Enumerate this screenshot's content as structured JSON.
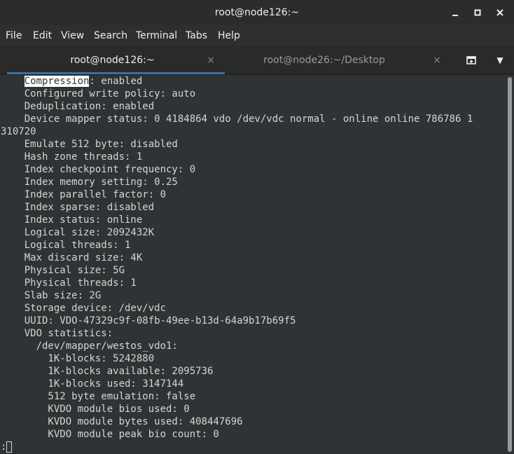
{
  "window": {
    "title": "root@node126:~",
    "minimize_label": "▁",
    "maximize_label": "□",
    "close_label": "✕"
  },
  "menubar": {
    "items": [
      "File",
      "Edit",
      "View",
      "Search",
      "Terminal",
      "Tabs",
      "Help"
    ]
  },
  "tabs": [
    {
      "label": "root@node126:~",
      "active": true,
      "close": "×"
    },
    {
      "label": "root@node26:~/Desktop",
      "active": false,
      "close": "×"
    }
  ],
  "tab_menu_label": "▼",
  "terminal": {
    "selected_word": "Compression",
    "lines": [
      ": enabled",
      "    Configured write policy: auto",
      "    Deduplication: enabled",
      "    Device mapper status: 0 4184864 vdo /dev/vdc normal - online online 786786 1",
      "310720",
      "    Emulate 512 byte: disabled",
      "    Hash zone threads: 1",
      "    Index checkpoint frequency: 0",
      "    Index memory setting: 0.25",
      "    Index parallel factor: 0",
      "    Index sparse: disabled",
      "    Index status: online",
      "    Logical size: 2092432K",
      "    Logical threads: 1",
      "    Max discard size: 4K",
      "    Physical size: 5G",
      "    Physical threads: 1",
      "    Slab size: 2G",
      "    Storage device: /dev/vdc",
      "    UUID: VDO-47329c9f-08fb-49ee-b13d-64a9b17b69f5",
      "    VDO statistics:",
      "      /dev/mapper/westos_vdo1:",
      "        1K-blocks: 5242880",
      "        1K-blocks available: 2095736",
      "        1K-blocks used: 3147144",
      "        512 byte emulation: false",
      "        KVDO module bios used: 0",
      "        KVDO module bytes used: 408447696",
      "        KVDO module peak bio count: 0"
    ],
    "prompt": ":"
  },
  "colors": {
    "terminal_bg": "#2e3436",
    "terminal_fg": "#d3d7cf",
    "accent": "#3b6fa8"
  }
}
